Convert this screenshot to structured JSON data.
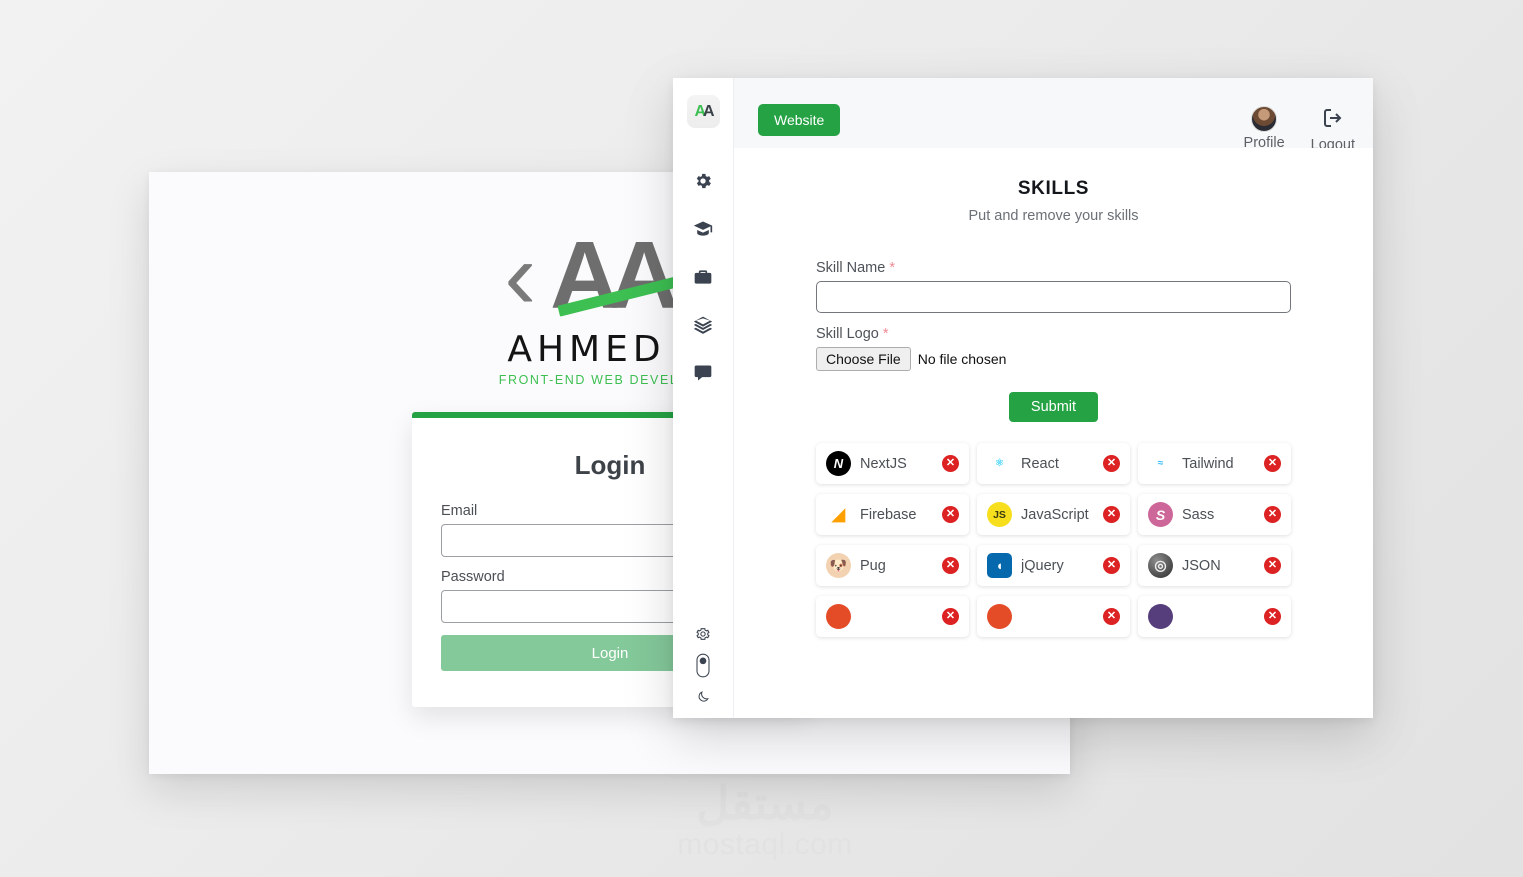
{
  "watermark": {
    "arabic": "مستقل",
    "latin": "mostaql.com"
  },
  "login_window": {
    "logo": {
      "left_angle": "‹",
      "initials": "AA",
      "right_angle": "›",
      "name": "AHMED A",
      "subtitle": "FRONT-END WEB DEVELOPER"
    },
    "card": {
      "title": "Login",
      "email_label": "Email",
      "email_value": "",
      "email_placeholder": "",
      "password_label": "Password",
      "password_value": "",
      "password_placeholder": "",
      "submit_label": "Login"
    }
  },
  "dashboard": {
    "sidebar": {
      "brand": {
        "left": "A",
        "right": "A"
      },
      "items": [
        {
          "name": "settings",
          "icon": "gear-icon"
        },
        {
          "name": "education",
          "icon": "graduation-cap-icon"
        },
        {
          "name": "portfolio",
          "icon": "briefcase-icon"
        },
        {
          "name": "skills",
          "icon": "layers-icon"
        },
        {
          "name": "messages",
          "icon": "comment-icon"
        }
      ],
      "bottom": [
        {
          "name": "preferences",
          "icon": "gear-outline-icon"
        },
        {
          "name": "theme-toggle",
          "icon": "toggle-switch-icon"
        },
        {
          "name": "dark-mode",
          "icon": "moon-icon"
        }
      ]
    },
    "topbar": {
      "website_label": "Website",
      "profile_label": "Profile",
      "logout_label": "Logout"
    },
    "skills": {
      "title": "SKILLS",
      "subtitle": "Put and remove your skills",
      "form": {
        "name_label": "Skill Name",
        "name_required": "*",
        "name_value": "",
        "name_placeholder": "",
        "logo_label": "Skill Logo",
        "logo_required": "*",
        "choose_file_label": "Choose File",
        "file_status": "No file chosen",
        "submit_label": "Submit"
      },
      "remove_glyph": "✕",
      "items": [
        {
          "label": "NextJS",
          "logo": "nextjs-logo",
          "logo_class": "lg-next",
          "glyph": "N"
        },
        {
          "label": "React",
          "logo": "react-logo",
          "logo_class": "lg-react",
          "glyph": "⚛"
        },
        {
          "label": "Tailwind",
          "logo": "tailwind-logo",
          "logo_class": "lg-tail",
          "glyph": "≈"
        },
        {
          "label": "Firebase",
          "logo": "firebase-logo",
          "logo_class": "lg-fire",
          "glyph": "◢"
        },
        {
          "label": "JavaScript",
          "logo": "javascript-logo",
          "logo_class": "lg-js",
          "glyph": "JS"
        },
        {
          "label": "Sass",
          "logo": "sass-logo",
          "logo_class": "lg-sass",
          "glyph": "S"
        },
        {
          "label": "Pug",
          "logo": "pug-logo",
          "logo_class": "lg-pug",
          "glyph": "🐶"
        },
        {
          "label": "jQuery",
          "logo": "jquery-logo",
          "logo_class": "lg-jq",
          "glyph": "◖"
        },
        {
          "label": "JSON",
          "logo": "json-logo",
          "logo_class": "lg-json",
          "glyph": "◎"
        },
        {
          "label": "",
          "logo": "partial-logo-1",
          "logo_class": "lg-red",
          "glyph": ""
        },
        {
          "label": "",
          "logo": "partial-logo-2",
          "logo_class": "lg-red",
          "glyph": ""
        },
        {
          "label": "",
          "logo": "partial-logo-3",
          "logo_class": "lg-purple",
          "glyph": ""
        }
      ]
    }
  },
  "colors": {
    "brand_green": "#25a244",
    "accent_green": "#3dbf52",
    "danger_red": "#dc2222",
    "required_red": "#ef8a94",
    "text_dark": "#3b4350",
    "text_muted": "#6b7076"
  }
}
